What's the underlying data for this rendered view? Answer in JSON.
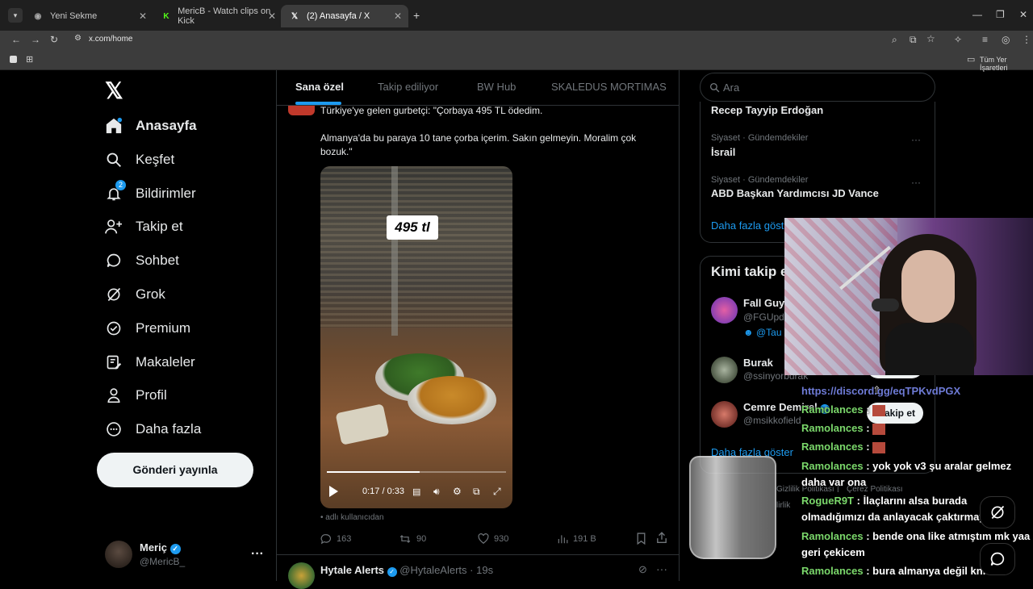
{
  "browser": {
    "tabs": [
      {
        "label": "Yeni Sekme"
      },
      {
        "label": "MericB - Watch clips on Kick"
      },
      {
        "label": "(2) Anasayfa / X"
      }
    ],
    "url": "x.com/home",
    "bookmarks_label": "Tüm Yer İşaretleri"
  },
  "nav": {
    "items": [
      {
        "label": "Anasayfa",
        "icon": "home-icon"
      },
      {
        "label": "Keşfet",
        "icon": "search-icon"
      },
      {
        "label": "Bildirimler",
        "icon": "bell-icon",
        "badge": "2"
      },
      {
        "label": "Takip et",
        "icon": "follow-icon"
      },
      {
        "label": "Sohbet",
        "icon": "chat-icon"
      },
      {
        "label": "Grok",
        "icon": "grok-icon"
      },
      {
        "label": "Premium",
        "icon": "premium-icon"
      },
      {
        "label": "Makaleler",
        "icon": "articles-icon"
      },
      {
        "label": "Profil",
        "icon": "profile-icon"
      },
      {
        "label": "Daha fazla",
        "icon": "more-icon"
      }
    ],
    "post_button": "Gönderi yayınla",
    "account": {
      "name": "Meriç",
      "handle": "@MericB_"
    }
  },
  "feed": {
    "tabs": [
      "Sana özel",
      "Takip ediliyor",
      "BW Hub",
      "SKALEDUS MORTIMAS"
    ],
    "post": {
      "line1": "Türkiye'ye gelen gurbetçi: \"Çorbaya 495 TL ödedim.",
      "line2": "Almanya'da bu paraya 10 tane çorba içerim. Sakın gelmeyin. Moralim çok bozuk.\"",
      "video_overlay": "495 tl",
      "video_time": "0:17 / 0:33",
      "video_progress": 0.52,
      "source_note": "adlı kullanıcıdan",
      "replies": "163",
      "reposts": "90",
      "likes": "930",
      "views": "191 B"
    },
    "next_post": {
      "name": "Hytale Alerts",
      "handle": "@HytaleAlerts",
      "time": "19s"
    }
  },
  "sidebar": {
    "search_placeholder": "Ara",
    "trends": [
      {
        "meta": "",
        "name": "Recep Tayyip Erdoğan"
      },
      {
        "meta": "Siyaset · Gündemdekiler",
        "name": "İsrail"
      },
      {
        "meta": "Siyaset · Gündemdekiler",
        "name": "ABD Başkan Yardımcısı JD Vance"
      }
    ],
    "show_more": "Daha fazla göster",
    "who_to_follow_title": "Kimi takip e",
    "follow": [
      {
        "name": "Fall Guys",
        "handle": "@FGUpd",
        "extra": "@Tau"
      },
      {
        "name": "Burak",
        "handle": "@ssinyorburak"
      },
      {
        "name": "Cemre Demirel",
        "handle": "@msikkofield"
      }
    ],
    "follow_button": "akip et",
    "show_more_2": "Daha fazla göster",
    "footer_1": "Gizlilik Politikası",
    "footer_2": "Çerez Politikası",
    "footer_3": "lirlik"
  },
  "chat": {
    "link_text": "https://discord.gg/eqTPKvdPGX",
    "lines": [
      {
        "user": "Ramolances",
        "text": ":"
      },
      {
        "user": "Ramolances",
        "text": ":"
      },
      {
        "user": "Ramolances",
        "text": ":"
      },
      {
        "user": "Ramolances",
        "text": ": yok yok v3 şu aralar gelmez daha var ona"
      },
      {
        "user": "RogueR9T",
        "text": ": İlaçlarını alsa burada olmadığımızı da anlayacak çaktırmayın"
      },
      {
        "user": "Ramolances",
        "text": ": bende ona like atmıştım mk yaa geri çekicem"
      },
      {
        "user": "Ramolances",
        "text": ": bura almanya değil knk"
      }
    ]
  }
}
